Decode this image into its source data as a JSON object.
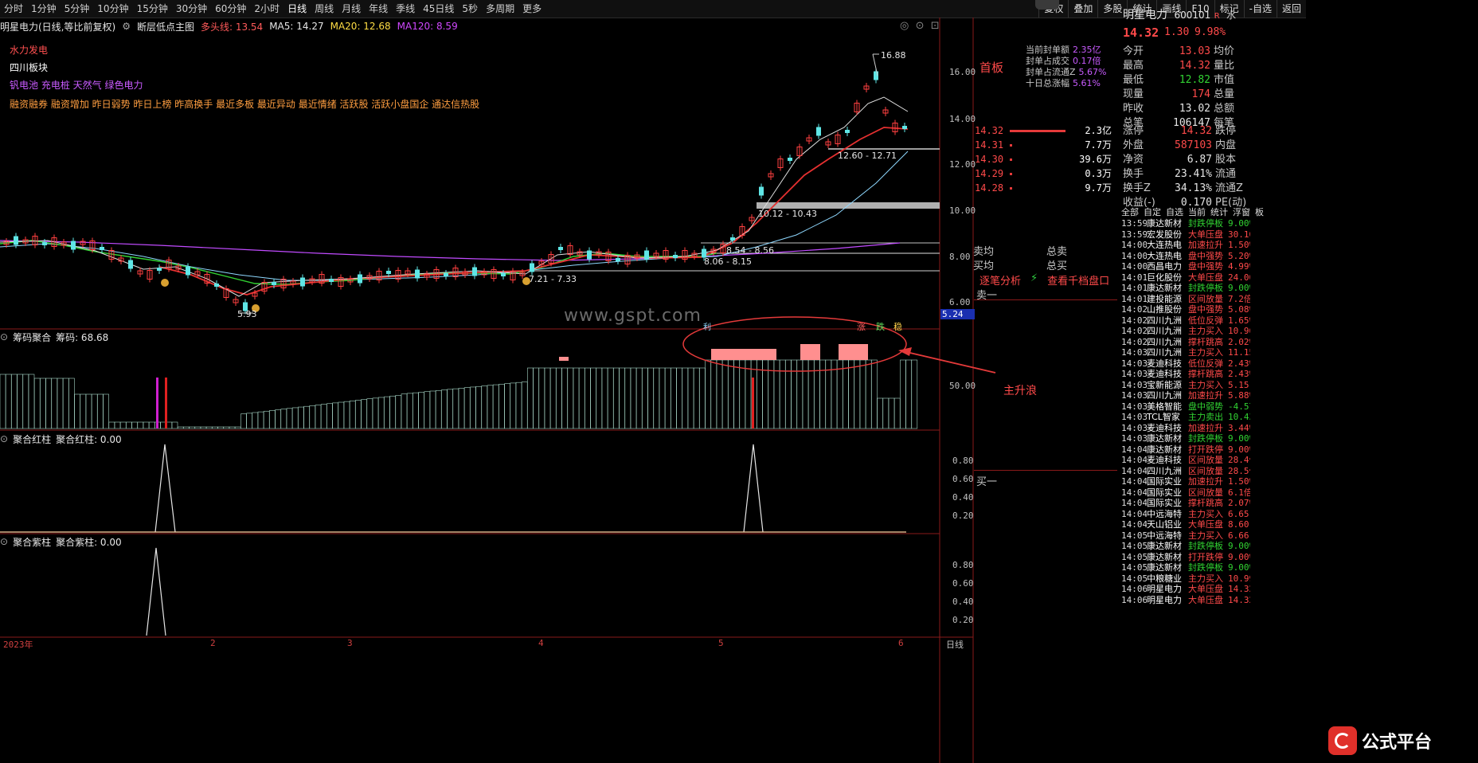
{
  "toolbar": {
    "timeframes": [
      "分时",
      "1分钟",
      "5分钟",
      "10分钟",
      "15分钟",
      "30分钟",
      "60分钟",
      "2小时",
      "日线",
      "周线",
      "月线",
      "年线",
      "季线",
      "45日线",
      "5秒",
      "多周期",
      "更多"
    ],
    "right_tools": [
      "复权",
      "叠加",
      "多股",
      "统计",
      "画线",
      "F10",
      "标记",
      "-自选",
      "返回"
    ]
  },
  "chart_header": {
    "stock_title": "明星电力(日线,等比前复权)",
    "indicator_name": "断层低点主图",
    "bull_line": "多头线: 13.54",
    "ma5": "MA5: 14.27",
    "ma20": "MA20: 12.68",
    "ma120": "MA120: 8.59"
  },
  "concepts": {
    "line1": "水力发电",
    "line2": "四川板块",
    "line3": "钒电池 充电桩 天然气 绿色电力",
    "line4": "融资融券 融资增加 昨日弱势 昨日上榜 昨高换手 最近多板 最近异动 最近情绪 活跃股 活跃小盘国企 通达信热股"
  },
  "price_axis": [
    "16.00",
    "14.00",
    "12.00",
    "10.00",
    "8.00",
    "6.00"
  ],
  "price_axis_current": "5.24",
  "annotations": {
    "high": "16.88",
    "low": "5.93",
    "band1": "12.60 - 12.71",
    "band2": "10.12 - 10.43",
    "band3": "8.54 - 8.56",
    "band4": "8.06 - 8.15",
    "band5": "7.21 - 7.33",
    "watermark": "www.gspt.com",
    "main_rise": "主升浪",
    "tag_zhang": "涨",
    "tag_die": "跌",
    "tag_wen": "稳",
    "tag_li": "利"
  },
  "panel_chip": {
    "name": "筹码聚合",
    "value": "筹码: 68.68",
    "axis": "50.00"
  },
  "panel_red": {
    "name": "聚合红柱",
    "value": "聚合红柱: 0.00",
    "axis": [
      "0.80",
      "0.60",
      "0.40",
      "0.20"
    ]
  },
  "panel_purple": {
    "name": "聚合紫柱",
    "value": "聚合紫柱: 0.00",
    "axis": [
      "0.80",
      "0.60",
      "0.40",
      "0.20"
    ]
  },
  "date_axis": [
    "2023年",
    "2",
    "3",
    "4",
    "5",
    "6"
  ],
  "date_axis_label": "日线",
  "quote": {
    "name": "明星电力",
    "code": "600101",
    "price": "14.32",
    "change": "1.30",
    "pct": "9.98%",
    "board": "首板",
    "seal": [
      {
        "label": "当前封单额",
        "value": "2.35亿"
      },
      {
        "label": "封单占成交",
        "value": "0.17倍"
      },
      {
        "label": "封单占流通Z",
        "value": "5.67%"
      },
      {
        "label": "十日总涨幅",
        "value": "5.61%"
      }
    ],
    "stats": [
      {
        "l": "今开",
        "v": "13.03",
        "l2": "均价"
      },
      {
        "l": "最高",
        "v": "14.32",
        "l2": "量比"
      },
      {
        "l": "最低",
        "v": "12.82",
        "l2": "市值"
      },
      {
        "l": "现量",
        "v": "174",
        "l2": "总量"
      },
      {
        "l": "昨收",
        "v": "13.02",
        "l2": "总额"
      },
      {
        "l": "总笔",
        "v": "106147",
        "l2": "每笔"
      }
    ],
    "order_book": [
      {
        "price": "14.32",
        "vol": "2.3亿"
      },
      {
        "price": "14.31",
        "vol": "7.7万"
      },
      {
        "price": "14.30",
        "vol": "39.6万"
      },
      {
        "price": "14.29",
        "vol": "0.3万"
      },
      {
        "price": "14.28",
        "vol": "9.7万"
      }
    ],
    "limits": [
      {
        "l": "涨停",
        "v": "14.32",
        "l2": "跌停"
      },
      {
        "l": "外盘",
        "v": "587103",
        "l2": "内盘"
      },
      {
        "l": "净资",
        "v": "6.87",
        "l2": "股本"
      },
      {
        "l": "换手",
        "v": "23.41%",
        "l2": "流通"
      },
      {
        "l": "换手Z",
        "v": "34.13%",
        "l2": "流通Z"
      },
      {
        "l": "收益(-)",
        "v": "0.170",
        "l2": "PE(动)"
      }
    ],
    "avg": [
      {
        "l": "卖均",
        "l2": "总卖"
      },
      {
        "l": "买均",
        "l2": "总买"
      }
    ],
    "links": {
      "analysis": "逐笔分析",
      "depth": "查看千档盘口"
    },
    "sell1": "卖一",
    "buy1": "买一"
  },
  "ticker_tabs": [
    "全部",
    "自定",
    "自选",
    "当前",
    "统计",
    "浮窗",
    "板"
  ],
  "ticker": [
    {
      "t": "13:59",
      "n": "康达新材",
      "e": "封跌停板",
      "v": "9.00%"
    },
    {
      "t": "13:59",
      "n": "宏发股份",
      "e": "大单压盘",
      "v": "30.10"
    },
    {
      "t": "14:00",
      "n": "大连热电",
      "e": "加速拉升",
      "v": "1.50%"
    },
    {
      "t": "14:00",
      "n": "大连热电",
      "e": "盘中强势",
      "v": "5.20%"
    },
    {
      "t": "14:00",
      "n": "西昌电力",
      "e": "盘中强势",
      "v": "4.99%"
    },
    {
      "t": "14:01",
      "n": "巨化股份",
      "e": "大单压盘",
      "v": "24.00"
    },
    {
      "t": "14:01",
      "n": "康达新材",
      "e": "封跌停板",
      "v": "9.00%"
    },
    {
      "t": "14:01",
      "n": "建投能源",
      "e": "区间放量",
      "v": "7.2倍"
    },
    {
      "t": "14:02",
      "n": "山推股份",
      "e": "盘中强势",
      "v": "5.08%"
    },
    {
      "t": "14:02",
      "n": "四川九洲",
      "e": "低位反弹",
      "v": "1.65%"
    },
    {
      "t": "14:02",
      "n": "四川九洲",
      "e": "主力买入",
      "v": "10.96"
    },
    {
      "t": "14:02",
      "n": "四川九洲",
      "e": "撑杆跳高",
      "v": "2.02%"
    },
    {
      "t": "14:03",
      "n": "四川九洲",
      "e": "主力买入",
      "v": "11.15"
    },
    {
      "t": "14:03",
      "n": "麦迪科技",
      "e": "低位反弹",
      "v": "2.43%"
    },
    {
      "t": "14:03",
      "n": "麦迪科技",
      "e": "撑杆跳高",
      "v": "2.43%"
    },
    {
      "t": "14:03",
      "n": "宝新能源",
      "e": "主力买入",
      "v": "5.15"
    },
    {
      "t": "14:03",
      "n": "四川九洲",
      "e": "加速拉升",
      "v": "5.88%"
    },
    {
      "t": "14:03",
      "n": "美格智能",
      "e": "盘中弱势",
      "v": "-4.57%"
    },
    {
      "t": "14:03",
      "n": "TCL智家",
      "e": "主力卖出",
      "v": "10.43"
    },
    {
      "t": "14:03",
      "n": "麦迪科技",
      "e": "加速拉升",
      "v": "3.44%"
    },
    {
      "t": "14:03",
      "n": "康达新材",
      "e": "封跌停板",
      "v": "9.00%"
    },
    {
      "t": "14:04",
      "n": "康达新材",
      "e": "打开跌停",
      "v": "9.00%"
    },
    {
      "t": "14:04",
      "n": "麦迪科技",
      "e": "区间放量",
      "v": "28.4倍"
    },
    {
      "t": "14:04",
      "n": "四川九洲",
      "e": "区间放量",
      "v": "28.5倍"
    },
    {
      "t": "14:04",
      "n": "国际实业",
      "e": "加速拉升",
      "v": "1.50%"
    },
    {
      "t": "14:04",
      "n": "国际实业",
      "e": "区间放量",
      "v": "6.1倍"
    },
    {
      "t": "14:04",
      "n": "国际实业",
      "e": "撑杆跳高",
      "v": "2.07%"
    },
    {
      "t": "14:04",
      "n": "中远海特",
      "e": "主力买入",
      "v": "6.65"
    },
    {
      "t": "14:04",
      "n": "天山铝业",
      "e": "大单压盘",
      "v": "8.60"
    },
    {
      "t": "14:05",
      "n": "中远海特",
      "e": "主力买入",
      "v": "6.66"
    },
    {
      "t": "14:05",
      "n": "康达新材",
      "e": "封跌停板",
      "v": "9.00%"
    },
    {
      "t": "14:05",
      "n": "康达新材",
      "e": "打开跌停",
      "v": "9.00%"
    },
    {
      "t": "14:05",
      "n": "康达新材",
      "e": "封跌停板",
      "v": "9.00%"
    },
    {
      "t": "14:05",
      "n": "中粮糖业",
      "e": "主力买入",
      "v": "10.99"
    },
    {
      "t": "14:06",
      "n": "明星电力",
      "e": "大单压盘",
      "v": "14.32"
    },
    {
      "t": "14:06",
      "n": "明星电力",
      "e": "大单压盘",
      "v": "14.32"
    }
  ],
  "right_edge": [
    "水",
    "近"
  ],
  "logo": {
    "text": "公式平台"
  }
}
